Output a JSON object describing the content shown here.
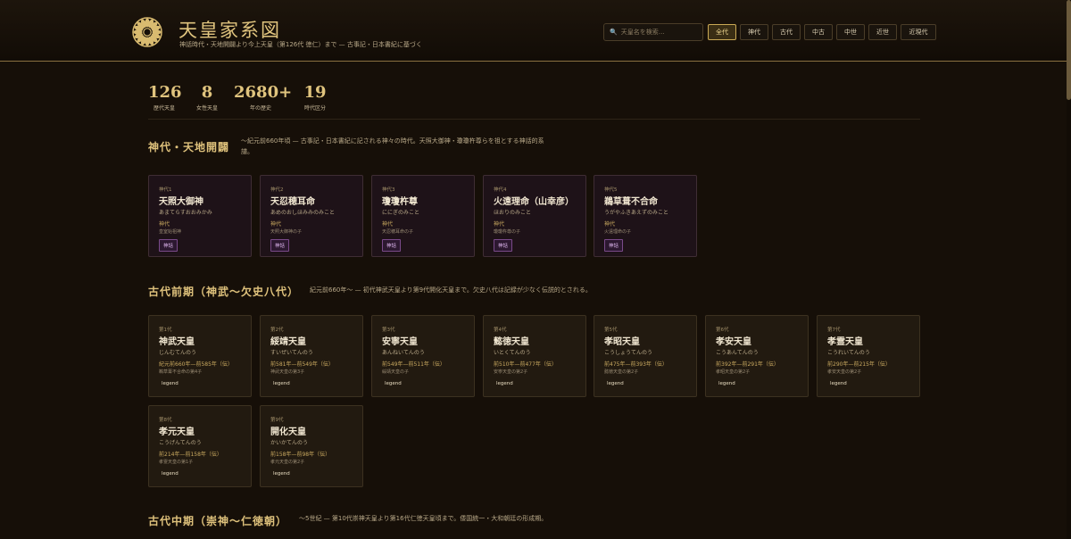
{
  "header": {
    "title": "天皇家系図",
    "subtitle": "神話時代・天地開闢より今上天皇（第126代 徳仁）まで — 古事記・日本書紀に基づく",
    "search_placeholder": "天皇名を検索…",
    "filters": [
      "全代",
      "神代",
      "古代",
      "中古",
      "中世",
      "近世",
      "近現代"
    ],
    "active_filter": "全代"
  },
  "stats": [
    {
      "num": "126",
      "label": "歴代天皇"
    },
    {
      "num": "8",
      "label": "女性天皇"
    },
    {
      "num": "2680+",
      "label": "年の歴史"
    },
    {
      "num": "19",
      "label": "時代区分"
    }
  ],
  "sections": [
    {
      "title": "神代・天地開闢",
      "desc": "〜紀元前660年頃 — 古事記・日本書紀に記される神々の時代。天照大御神・瓊瓊杵尊らを祖とする神話的系譜。",
      "cards": [
        {
          "gen": "神代1",
          "name": "天照大御神",
          "kana": "あまてらすおおみかみ",
          "era": "神代",
          "rel": "皇室始祖神",
          "tag": "神話"
        },
        {
          "gen": "神代2",
          "name": "天忍穂耳命",
          "kana": "あめのおしほみみのみこと",
          "era": "神代",
          "rel": "天照大御神の子",
          "tag": "神話"
        },
        {
          "gen": "神代3",
          "name": "瓊瓊杵尊",
          "kana": "ににぎのみこと",
          "era": "神代",
          "rel": "天忍穂耳命の子",
          "tag": "神話"
        },
        {
          "gen": "神代4",
          "name": "火遠理命（山幸彦）",
          "kana": "ほおりのみこと",
          "era": "神代",
          "rel": "瓊瓊杵尊の子",
          "tag": "神話"
        },
        {
          "gen": "神代5",
          "name": "鵜草葺不合命",
          "kana": "うがやふきあえずのみこと",
          "era": "神代",
          "rel": "火遠理命の子",
          "tag": "神話"
        }
      ]
    },
    {
      "title": "古代前期（神武〜欠史八代）",
      "desc": "紀元前660年〜 — 初代神武天皇より第9代開化天皇まで。欠史八代は記録が少なく伝説的とされる。",
      "cards": [
        {
          "gen": "第1代",
          "name": "神武天皇",
          "kana": "じんむてんのう",
          "era": "紀元前660年—前585年（伝）",
          "rel": "鵜草葺不合命の第4子",
          "tag": "legend"
        },
        {
          "gen": "第2代",
          "name": "綏靖天皇",
          "kana": "すいぜいてんのう",
          "era": "前581年—前549年（伝）",
          "rel": "神武天皇の第3子",
          "tag": "legend"
        },
        {
          "gen": "第3代",
          "name": "安寧天皇",
          "kana": "あんねいてんのう",
          "era": "前549年—前511年（伝）",
          "rel": "綏靖天皇の子",
          "tag": "legend"
        },
        {
          "gen": "第4代",
          "name": "懿徳天皇",
          "kana": "いとくてんのう",
          "era": "前510年—前477年（伝）",
          "rel": "安寧天皇の第2子",
          "tag": "legend"
        },
        {
          "gen": "第5代",
          "name": "孝昭天皇",
          "kana": "こうしょうてんのう",
          "era": "前475年—前393年（伝）",
          "rel": "懿徳天皇の第2子",
          "tag": "legend"
        },
        {
          "gen": "第6代",
          "name": "孝安天皇",
          "kana": "こうあんてんのう",
          "era": "前392年—前291年（伝）",
          "rel": "孝昭天皇の第2子",
          "tag": "legend"
        },
        {
          "gen": "第7代",
          "name": "孝霊天皇",
          "kana": "こうれいてんのう",
          "era": "前290年—前215年（伝）",
          "rel": "孝安天皇の第2子",
          "tag": "legend"
        },
        {
          "gen": "第8代",
          "name": "孝元天皇",
          "kana": "こうげんてんのう",
          "era": "前214年—前158年（伝）",
          "rel": "孝霊天皇の第1子",
          "tag": "legend"
        },
        {
          "gen": "第9代",
          "name": "開化天皇",
          "kana": "かいかてんのう",
          "era": "前158年—前98年（伝）",
          "rel": "孝元天皇の第2子",
          "tag": "legend"
        }
      ]
    },
    {
      "title": "古代中期（崇神〜仁徳朝）",
      "desc": "〜5世紀 — 第10代崇神天皇より第16代仁徳天皇頃まで。倭国統一・大和朝廷の形成期。",
      "cards": []
    }
  ],
  "colors": {
    "accent": "#e0c47e",
    "background": "#160f08",
    "card": "#221a10",
    "myth_tag": "#7a4a8a"
  }
}
